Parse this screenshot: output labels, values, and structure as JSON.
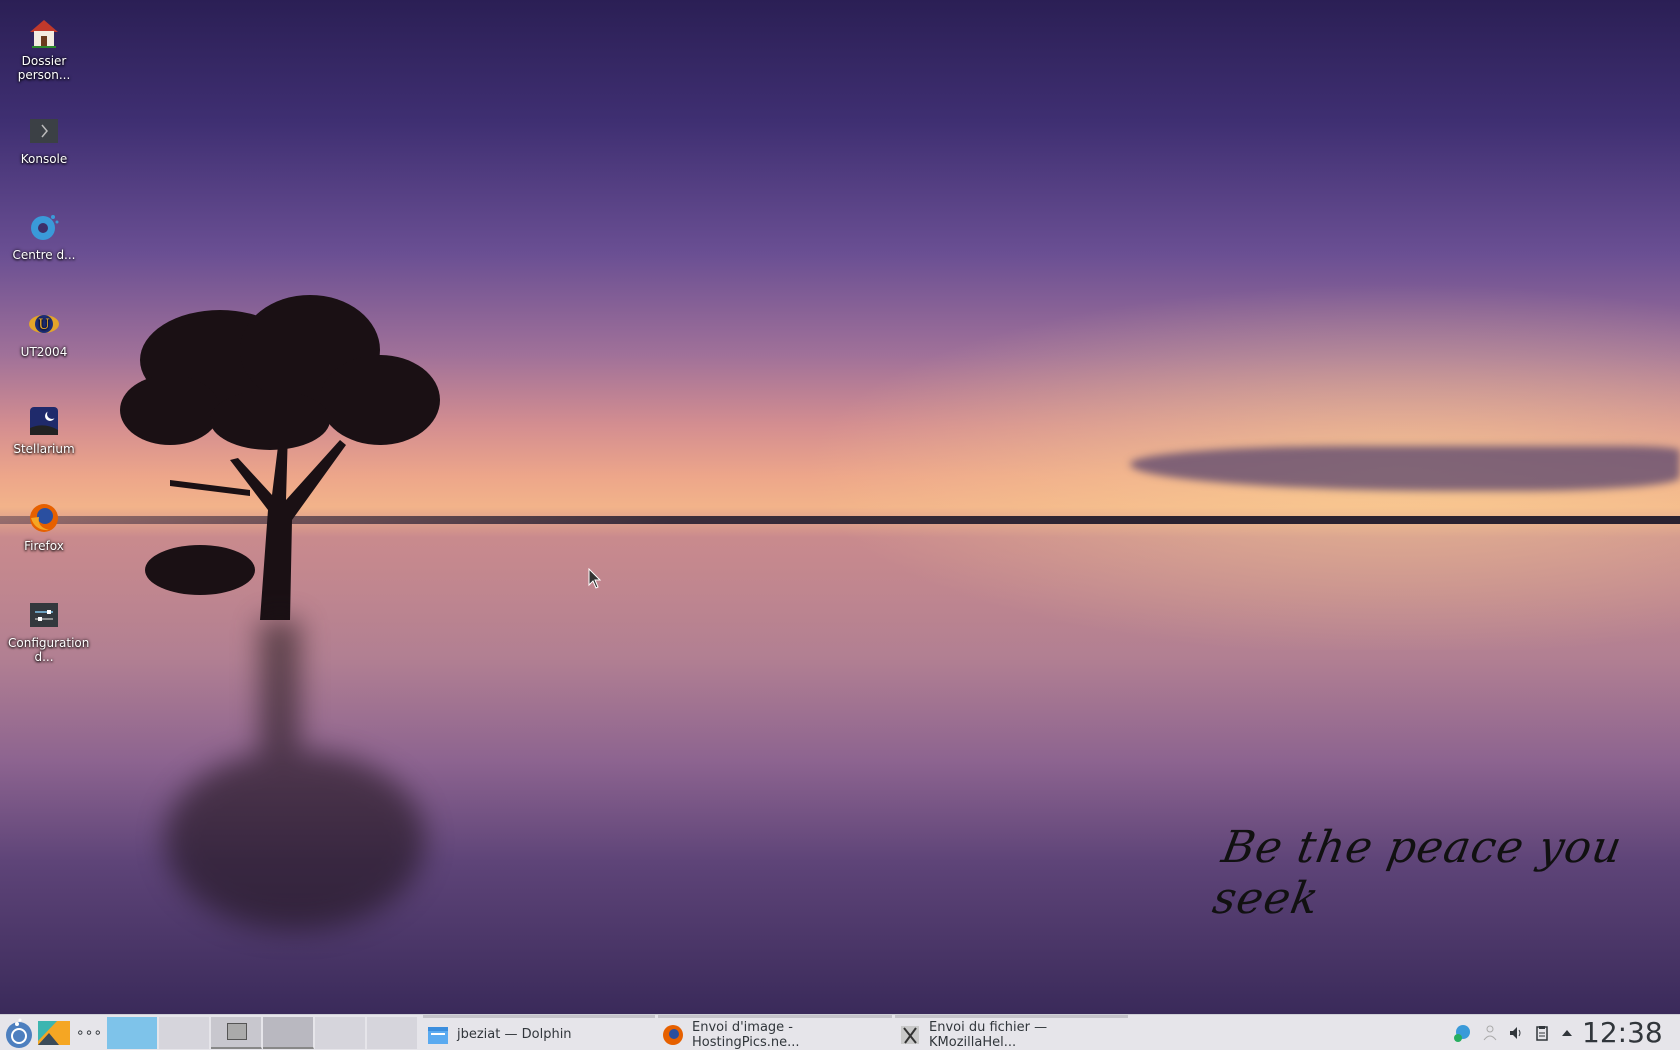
{
  "desktop": {
    "icons": [
      {
        "label": "Dossier person...",
        "icon": "home-folder-icon"
      },
      {
        "label": "Konsole",
        "icon": "terminal-icon"
      },
      {
        "label": "Centre d...",
        "icon": "gear-icon"
      },
      {
        "label": "UT2004",
        "icon": "ut2004-icon"
      },
      {
        "label": "Stellarium",
        "icon": "stellarium-icon"
      },
      {
        "label": "Firefox",
        "icon": "firefox-icon"
      },
      {
        "label": "Configuration d...",
        "icon": "settings-sliders-icon"
      }
    ],
    "wallpaper_quote": "Be the peace you seek"
  },
  "taskbar": {
    "pager_count": 6,
    "active_desktop": 1,
    "tasks": [
      {
        "label": "jbeziat — Dolphin",
        "icon": "folder-icon"
      },
      {
        "label": "Envoi d'image - HostingPics.ne...",
        "icon": "firefox-icon"
      },
      {
        "label": "Envoi du fichier — KMozillaHel...",
        "icon": "x-app-icon"
      }
    ],
    "clock": "12:38"
  },
  "colors": {
    "accent": "#7ec3ea",
    "panel": "#e6e5ea"
  }
}
